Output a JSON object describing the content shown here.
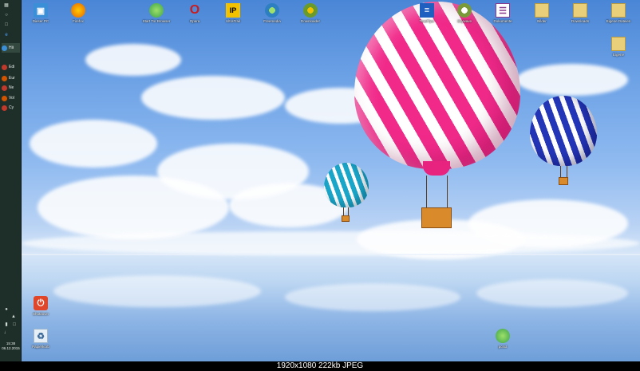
{
  "taskbar": {
    "items": [
      {
        "label": "Edi",
        "color": "#c0392b"
      },
      {
        "label": "Eur",
        "color": "#d35400"
      },
      {
        "label": "Ne",
        "color": "#c0392b"
      },
      {
        "label": "Vol",
        "color": "#d35400"
      },
      {
        "label": "Cy",
        "color": "#c0392b"
      }
    ],
    "active_item": {
      "label": "Hä"
    },
    "clock": {
      "time": "15:38",
      "date": "06.12.2015"
    }
  },
  "desktop_icons_top": [
    {
      "label": "Dieser PC",
      "icon": "computer-icon",
      "color": "#3b8fd6"
    },
    {
      "label": "Firefox",
      "icon": "firefox-icon",
      "color": "#e66000"
    },
    {
      "label": "Start Tor Browser",
      "icon": "tor-icon",
      "color": "#3aa24a"
    },
    {
      "label": "Opera",
      "icon": "opera-icon",
      "color": "#cc1b1b"
    },
    {
      "label": "UltraTrail",
      "icon": "ultratrail-icon",
      "color": "#f2c200"
    },
    {
      "label": "Freemedia",
      "icon": "freemedia-icon",
      "color": "#2d7fc1"
    },
    {
      "label": "Downloader",
      "icon": "downloader-icon",
      "color": "#6a9a2a"
    },
    {
      "label": "TrueFlyer",
      "icon": "trueflyer-icon",
      "color": "#1f5fbf"
    },
    {
      "label": "Skywave",
      "icon": "skywave-icon",
      "color": "#7a9a3a"
    },
    {
      "label": "Dokumente",
      "icon": "documents-icon",
      "color": "#8a3a8a"
    },
    {
      "label": "Bilder",
      "icon": "pictures-folder-icon",
      "color": "#e9cf7a"
    },
    {
      "label": "Downloads",
      "icon": "downloads-folder-icon",
      "color": "#e9cf7a"
    },
    {
      "label": "Eigene Dateien",
      "icon": "folder-icon",
      "color": "#e9cf7a"
    }
  ],
  "desktop_icons_misc": [
    {
      "label": "Eigene",
      "icon": "folder-icon",
      "color": "#e9cf7a"
    },
    {
      "label": "Shutdown",
      "icon": "power-icon",
      "color": "#e0472a"
    },
    {
      "label": "Papierkorb",
      "icon": "recycle-bin-icon",
      "color": "#9fb7cc"
    },
    {
      "label": "pcsxt",
      "icon": "app-icon",
      "color": "#3aa24a"
    }
  ],
  "caption": "1920x1080  222kb  JPEG"
}
